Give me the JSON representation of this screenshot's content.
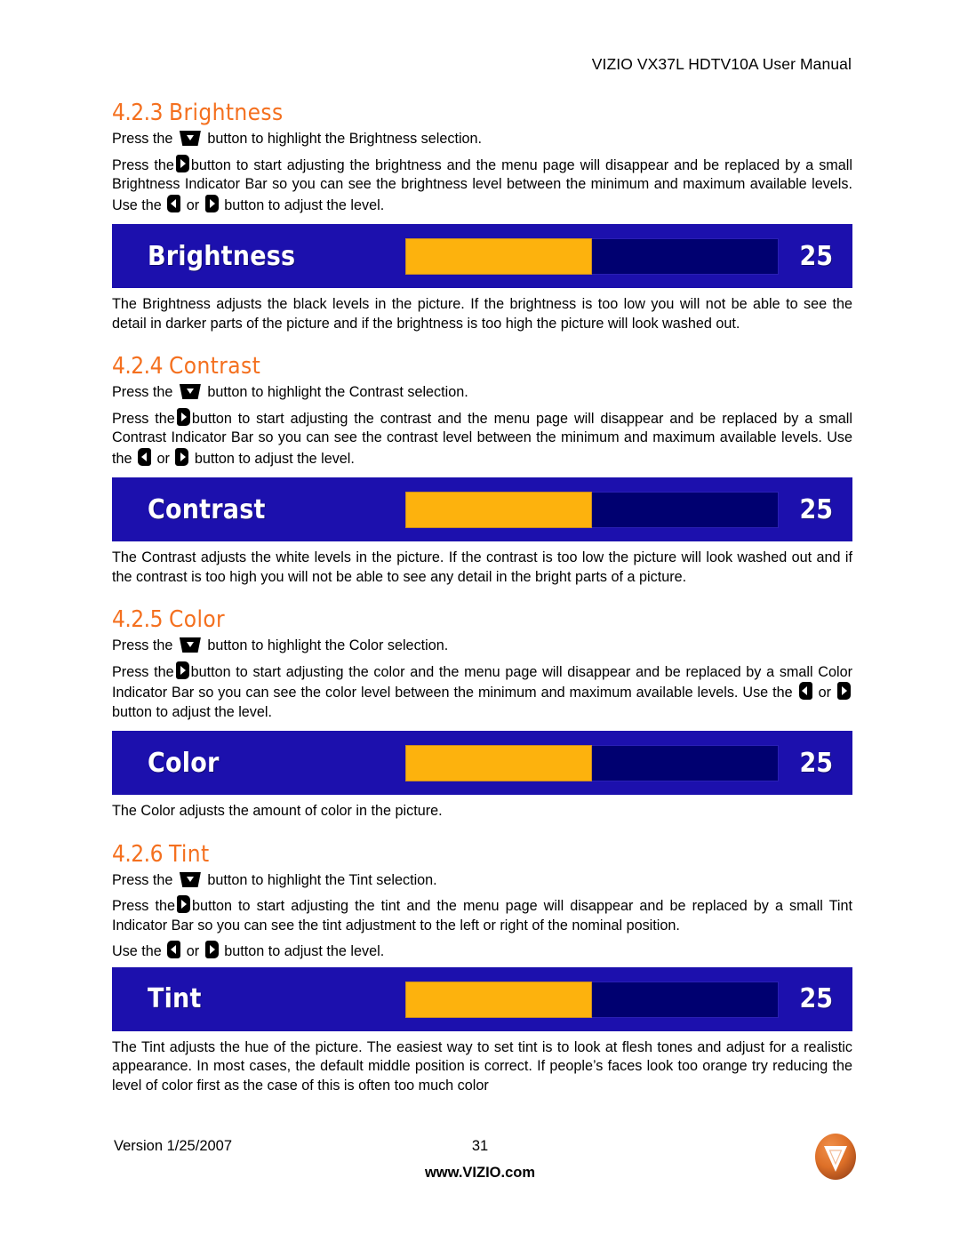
{
  "header": {
    "title": "VIZIO VX37L HDTV10A User Manual"
  },
  "theme": {
    "heading_color": "#F4701F",
    "osd_background": "#1C10AD",
    "osd_track": "#000070",
    "osd_fill": "#FDB20D",
    "osd_text": "#FFFFFF",
    "logo_color": "#E2732B"
  },
  "sections": [
    {
      "number": "4.2.3",
      "title": "Brightness",
      "paragraph1_a": "Press the",
      "paragraph1_b": "button to highlight the Brightness selection.",
      "paragraph2_a": "Press the",
      "paragraph2_b": "button to start adjusting the brightness and the menu page will disappear and be replaced by a small Brightness Indicator Bar so you can see the brightness level between the minimum and maximum available levels.  Use the",
      "paragraph2_c": "or",
      "paragraph2_d": "button to adjust the level.",
      "osd": {
        "label": "Brightness",
        "value": "25",
        "fill_percent": 50
      },
      "paragraph3": "The Brightness adjusts the black levels in the picture.  If the brightness is too low you will not be able to see the detail in darker parts of the picture and if the brightness is too high the picture will look washed out."
    },
    {
      "number": "4.2.4",
      "title": "Contrast",
      "paragraph1_a": "Press the",
      "paragraph1_b": "button to highlight the Contrast selection.",
      "paragraph2_a": "Press the",
      "paragraph2_b": "button to start adjusting the contrast and the menu page will disappear and be replaced by a small Contrast Indicator Bar so you can see the contrast level between the minimum and maximum available levels.  Use the",
      "paragraph2_c": "or",
      "paragraph2_d": "button to adjust the level.",
      "osd": {
        "label": "Contrast",
        "value": "25",
        "fill_percent": 50
      },
      "paragraph3": "The Contrast adjusts the white levels in the picture.  If the contrast is too low the picture will look washed out and if the contrast is too high you will not be able to see any detail in the bright parts of a picture."
    },
    {
      "number": "4.2.5",
      "title": "Color",
      "paragraph1_a": "Press the",
      "paragraph1_b": "button to highlight the Color selection.",
      "paragraph2_a": "Press the",
      "paragraph2_b": "button to start adjusting the color and the menu page will disappear and be replaced by a small Color Indicator Bar so you can see the color level between the minimum and maximum available levels.  Use the",
      "paragraph2_c": "or",
      "paragraph2_d": "button to adjust the level.",
      "osd": {
        "label": "Color",
        "value": "25",
        "fill_percent": 50
      },
      "paragraph3": "The Color adjusts the amount of color in the picture."
    },
    {
      "number": "4.2.6",
      "title": "Tint",
      "paragraph1_a": "Press the",
      "paragraph1_b": "button to highlight the Tint selection.",
      "paragraph2_a": "Press the",
      "paragraph2_b": "button to start adjusting the tint and the menu page will disappear and be replaced by a small Tint Indicator Bar so you can see the tint adjustment to the left or right of the nominal position.",
      "paragraph2_c": "Use the",
      "paragraph2_d": "or",
      "paragraph2_e": "button to adjust the level.",
      "osd": {
        "label": "Tint",
        "value": "25",
        "fill_percent": 50
      },
      "paragraph3": "The Tint adjusts the hue of the picture.  The easiest way to set tint is to look at flesh tones and adjust for a realistic appearance.  In most cases, the default middle position is correct.  If people’s faces look too orange try reducing the level of color first as the case of this is often too much color"
    }
  ],
  "footer": {
    "version": "Version 1/25/2007",
    "page_number": "31",
    "website": "www.VIZIO.com",
    "logo_letter": "V"
  }
}
